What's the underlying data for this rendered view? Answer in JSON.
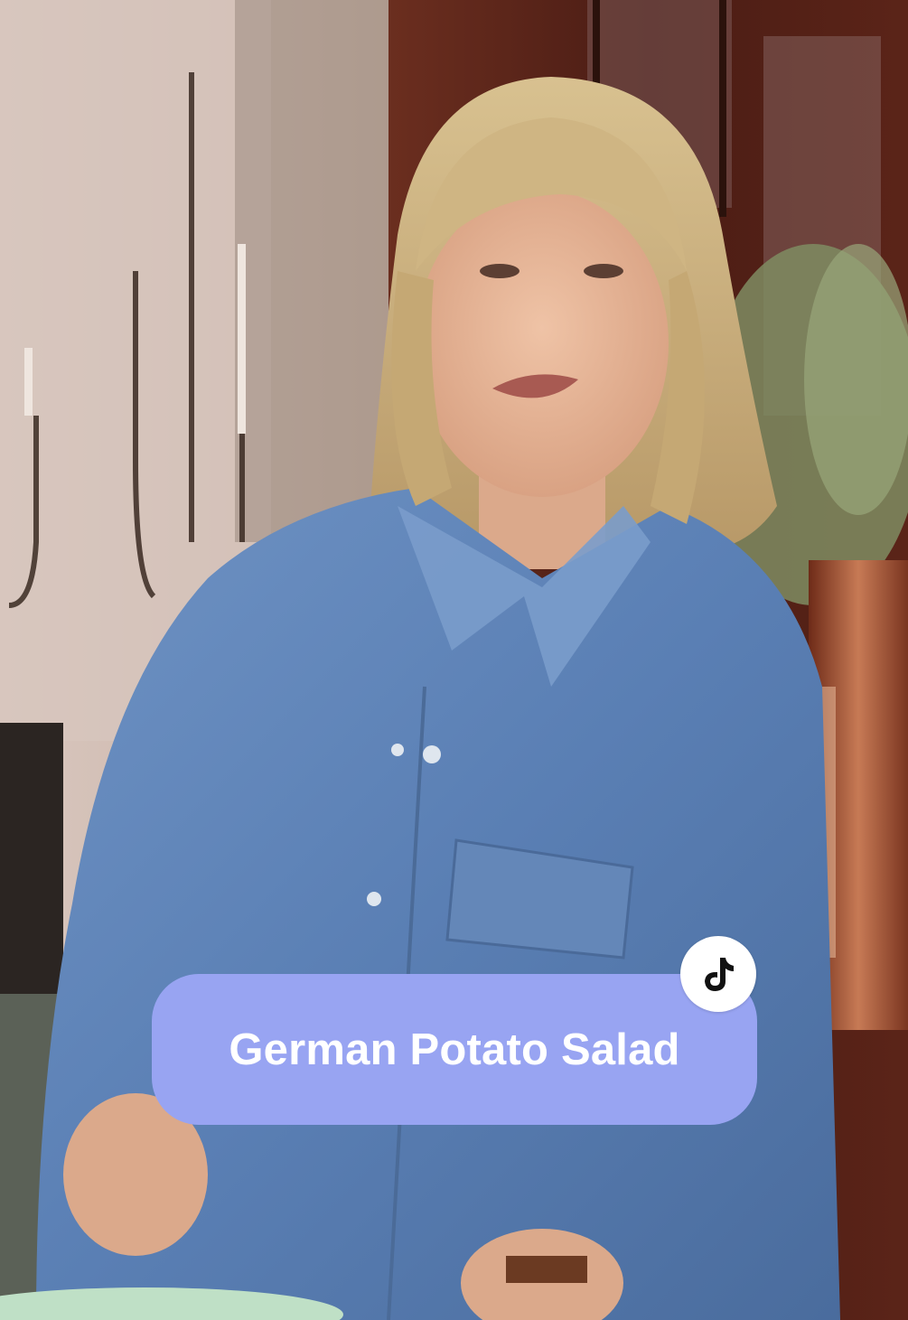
{
  "overlay": {
    "title": "German Potato Salad",
    "badge_icon": "tiktok-logo-icon",
    "bubble_color": "#98a4f2",
    "text_color": "#ffffff"
  },
  "scene": {
    "subject": "presenter-in-denim-shirt",
    "setting": "kitchen"
  }
}
